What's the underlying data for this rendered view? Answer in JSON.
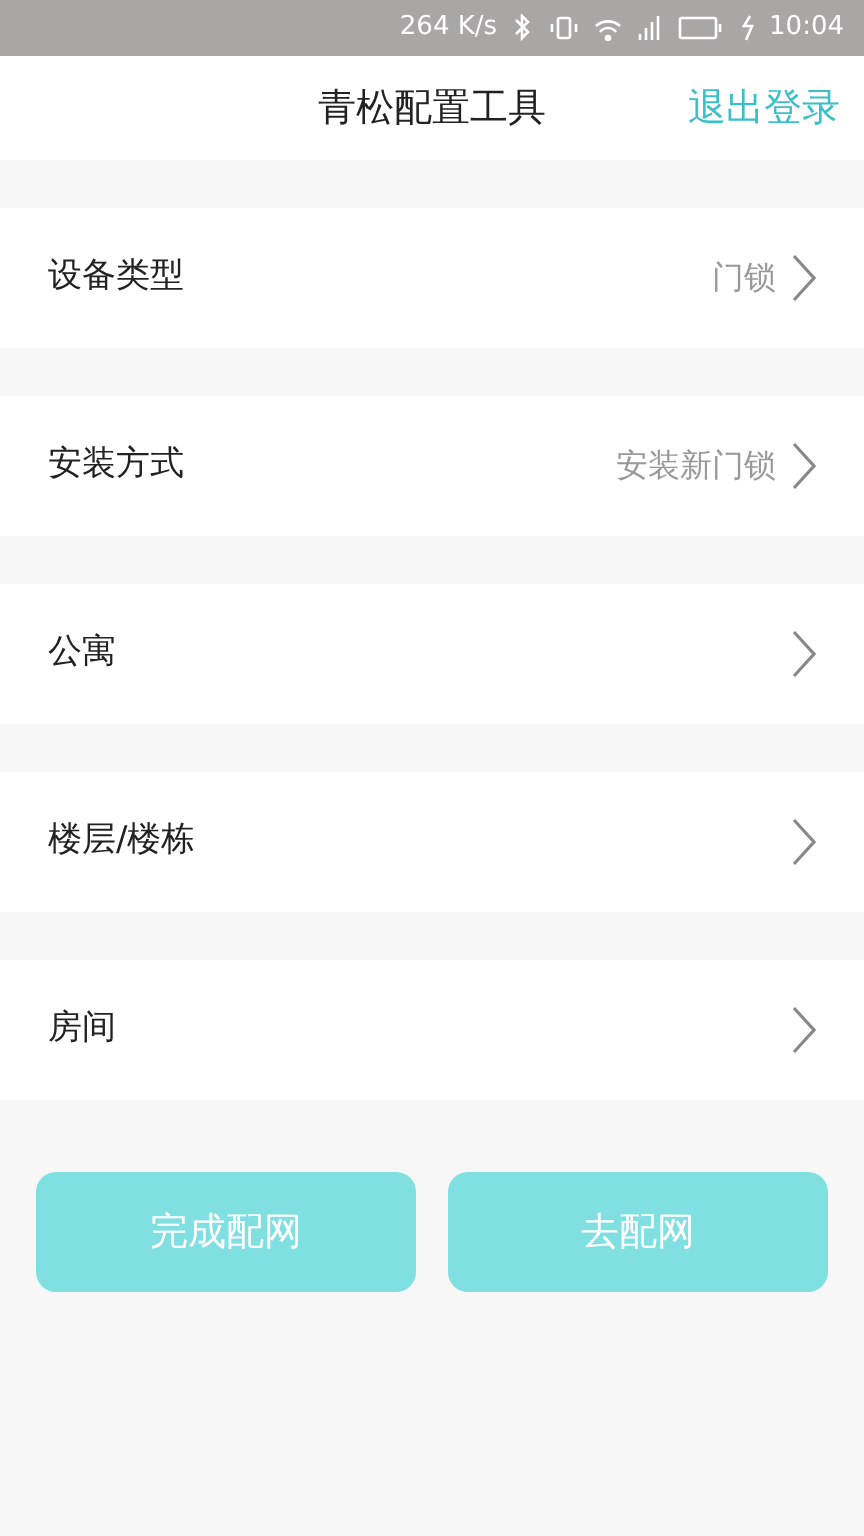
{
  "status_bar": {
    "speed": "264 K/s",
    "time": "10:04"
  },
  "header": {
    "title": "青松配置工具",
    "action": "退出登录"
  },
  "rows": [
    {
      "label": "设备类型",
      "value": "门锁"
    },
    {
      "label": "安装方式",
      "value": "安装新门锁"
    },
    {
      "label": "公寓"
    },
    {
      "label": "楼层/楼栋"
    },
    {
      "label": "房间"
    }
  ],
  "buttons": [
    "完成配网",
    "去配网"
  ]
}
